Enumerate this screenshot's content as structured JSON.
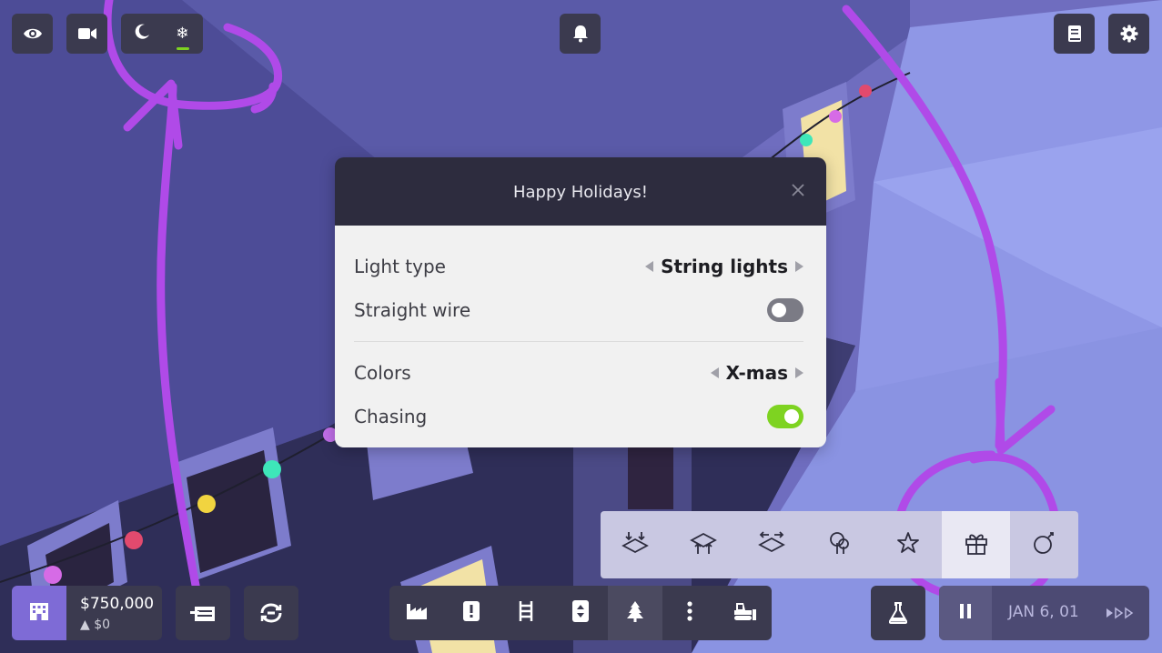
{
  "top_left": {
    "view_icon": "eye-icon",
    "camera_icon": "video-camera-icon",
    "night_icon": "moon-icon",
    "winter_icon": "snowflake-icon",
    "winter_active": true
  },
  "top_center": {
    "notifications_icon": "bell-icon"
  },
  "top_right": {
    "book_icon": "book-icon",
    "settings_icon": "gear-icon"
  },
  "dialog": {
    "title": "Happy Holidays!",
    "close_icon": "close-icon",
    "rows": [
      {
        "label": "Light type",
        "type": "selector",
        "value": "String lights"
      },
      {
        "label": "Straight wire",
        "type": "toggle",
        "on": false
      },
      {
        "label": "Colors",
        "type": "selector",
        "value": "X-mas"
      },
      {
        "label": "Chasing",
        "type": "toggle",
        "on": true
      }
    ]
  },
  "decorations_bar": {
    "tools": [
      {
        "icon": "ground-lights-icon"
      },
      {
        "icon": "roof-lights-icon"
      },
      {
        "icon": "wall-lights-icon"
      },
      {
        "icon": "tree-lights-icon"
      },
      {
        "icon": "star-icon"
      },
      {
        "icon": "gift-icon",
        "selected": true
      },
      {
        "icon": "ornament-icon"
      }
    ]
  },
  "bottom_left": {
    "building_icon": "building-icon",
    "money": "$750,000",
    "money_delta": "▲ $0",
    "construction_icon": "blueprint-icon",
    "demolish_icon": "recycle-icon"
  },
  "bottom_center": {
    "tools": [
      {
        "icon": "factory-icon"
      },
      {
        "icon": "warning-icon"
      },
      {
        "icon": "ladder-icon"
      },
      {
        "icon": "elevator-icon"
      },
      {
        "icon": "tree-icon",
        "active": true
      },
      {
        "icon": "more-icon"
      },
      {
        "icon": "bulldozer-icon"
      }
    ]
  },
  "bottom_right": {
    "research_icon": "flask-icon",
    "pause_icon": "pause-icon",
    "date": "JAN 6, 01",
    "speed_icon": "fast-forward-icon"
  },
  "colors": {
    "accent_green": "#7ed321",
    "accent_purple": "#b04ae8",
    "panel_dark": "#3b3a4f"
  }
}
